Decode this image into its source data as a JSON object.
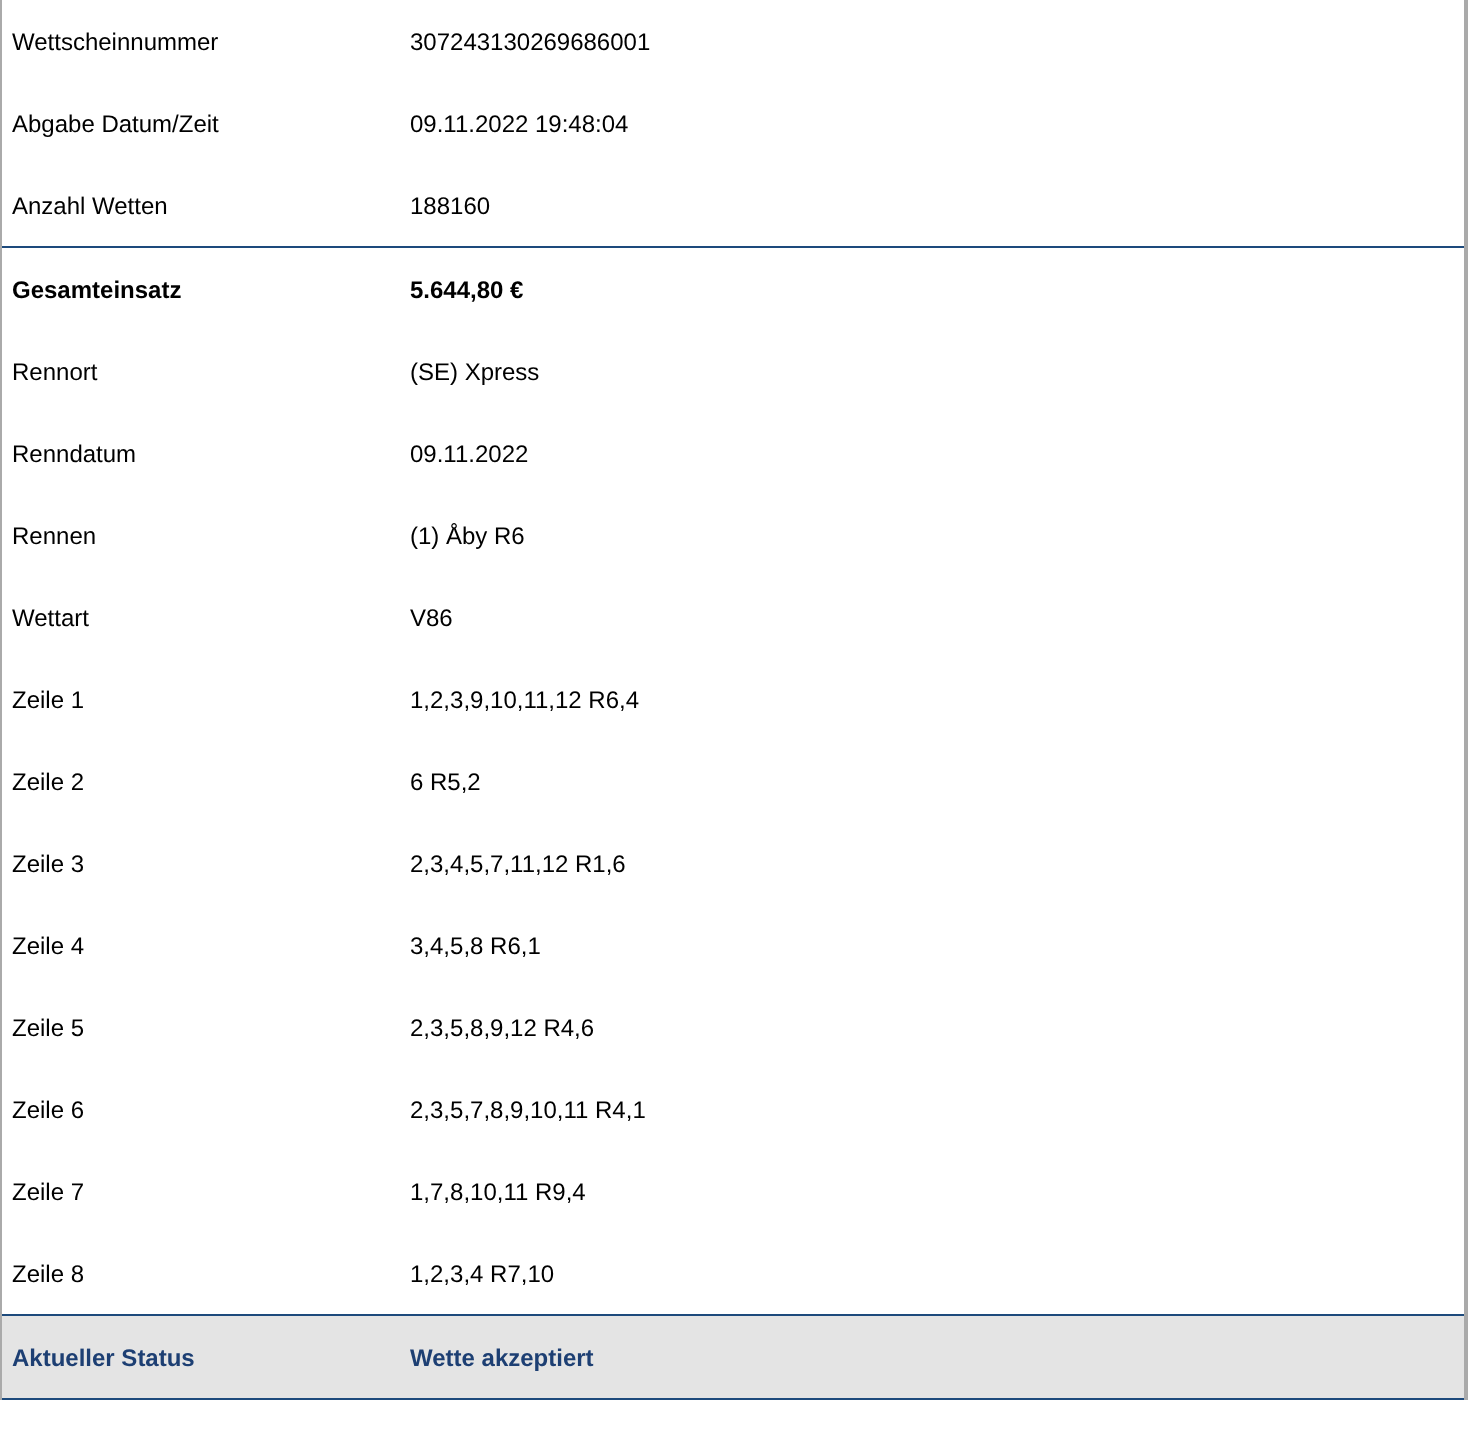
{
  "rows": [
    {
      "kind": "normal",
      "label": "Wettscheinnummer",
      "value": "307243130269686001"
    },
    {
      "kind": "normal",
      "label": "Abgabe Datum/Zeit",
      "value": "09.11.2022 19:48:04"
    },
    {
      "kind": "normal",
      "label": "Anzahl Wetten",
      "value": "188160"
    },
    {
      "kind": "total",
      "label": "Gesamteinsatz",
      "value": "5.644,80 €"
    },
    {
      "kind": "normal",
      "label": "Rennort",
      "value": "(SE) Xpress"
    },
    {
      "kind": "normal",
      "label": "Renndatum",
      "value": "09.11.2022"
    },
    {
      "kind": "normal",
      "label": "Rennen",
      "value": "(1) Åby R6"
    },
    {
      "kind": "normal",
      "label": "Wettart",
      "value": "V86"
    },
    {
      "kind": "normal",
      "label": "Zeile 1",
      "value": "1,2,3,9,10,11,12 R6,4"
    },
    {
      "kind": "normal",
      "label": "Zeile 2",
      "value": "6 R5,2"
    },
    {
      "kind": "normal",
      "label": "Zeile 3",
      "value": "2,3,4,5,7,11,12 R1,6"
    },
    {
      "kind": "normal",
      "label": "Zeile 4",
      "value": "3,4,5,8 R6,1"
    },
    {
      "kind": "normal",
      "label": "Zeile 5",
      "value": "2,3,5,8,9,12 R4,6"
    },
    {
      "kind": "normal",
      "label": "Zeile 6",
      "value": "2,3,5,7,8,9,10,11 R4,1"
    },
    {
      "kind": "normal",
      "label": "Zeile 7",
      "value": "1,7,8,10,11 R9,4"
    },
    {
      "kind": "normal",
      "label": "Zeile 8",
      "value": "1,2,3,4 R7,10"
    },
    {
      "kind": "status",
      "label": "Aktueller Status",
      "value": "Wette akzeptiert"
    }
  ]
}
